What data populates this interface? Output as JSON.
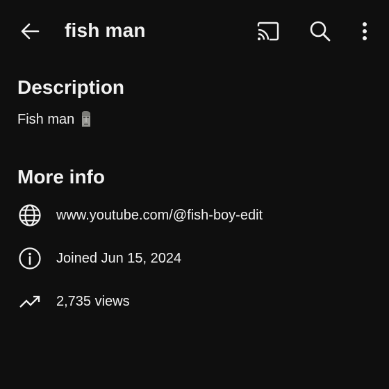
{
  "header": {
    "title": "fish man",
    "icons": {
      "back": "arrow-back-icon",
      "cast": "cast-icon",
      "search": "search-icon",
      "more": "more-vert-icon"
    }
  },
  "description": {
    "heading": "Description",
    "text": "Fish man",
    "emoji": "moai-icon"
  },
  "more_info": {
    "heading": "More info",
    "rows": [
      {
        "icon": "globe-icon",
        "text": "www.youtube.com/@fish-boy-edit"
      },
      {
        "icon": "info-icon",
        "text": "Joined Jun 15, 2024"
      },
      {
        "icon": "trending-icon",
        "text": "2,735 views"
      }
    ]
  },
  "colors": {
    "background": "#0f0f0f",
    "text": "#f1f1f1"
  }
}
